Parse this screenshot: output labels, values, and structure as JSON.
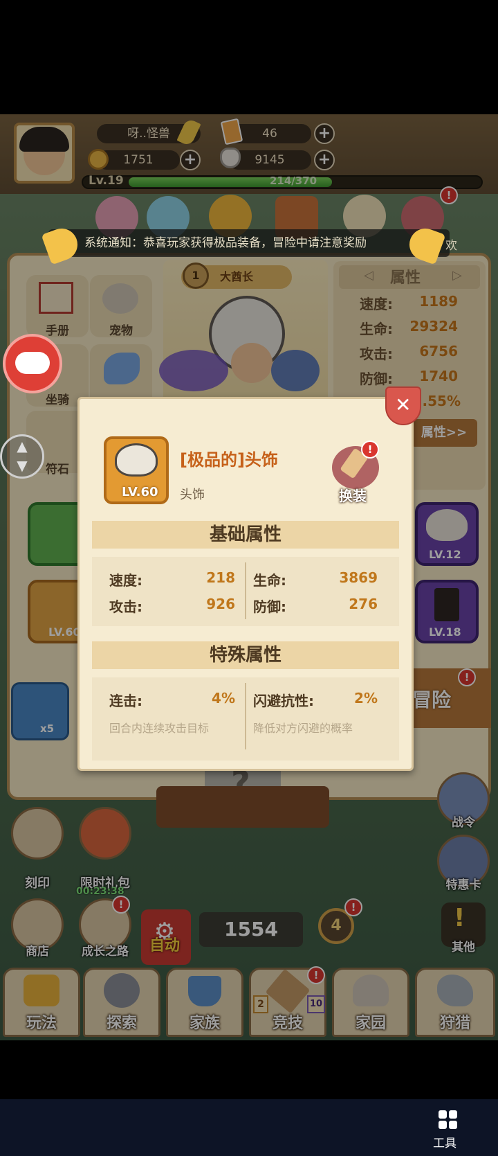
{
  "player": {
    "name": "呀..怪兽",
    "tickets": "46",
    "gold": "1751",
    "gems": "9145",
    "level": "Lv.19",
    "exp": "214/370",
    "exp_progress": 0.578
  },
  "banner": {
    "text": "系统通知：恭喜玩家获得极品装备，冒险中请注意奖励",
    "right_fragment": "欢"
  },
  "sidebar_left": [
    "手册",
    "宠物",
    "坐骑",
    "符石"
  ],
  "hero": {
    "rank_number": "1",
    "rank_title": "大酋长"
  },
  "attributes": {
    "title": "属性",
    "rows": [
      {
        "label": "速度:",
        "value": "1189"
      },
      {
        "label": "生命:",
        "value": "29324"
      },
      {
        "label": "攻击:",
        "value": "6756"
      },
      {
        "label": "防御:",
        "value": "1740"
      },
      {
        "label": "",
        "value": "3.55%"
      }
    ],
    "more_button": "属性>>"
  },
  "equipment": [
    {
      "level": "LV.12"
    },
    {
      "level": "LV.18"
    },
    {
      "level": "LV.60"
    }
  ],
  "adventure": {
    "label": "冒险",
    "chest_count": "x5"
  },
  "modal": {
    "item_name": "[极品的]头饰",
    "item_type": "头饰",
    "item_level": "LV.60",
    "swap_button": "换装",
    "basic_title": "基础属性",
    "basic_stats": [
      {
        "label": "速度:",
        "value": "218"
      },
      {
        "label": "生命:",
        "value": "3869"
      },
      {
        "label": "攻击:",
        "value": "926"
      },
      {
        "label": "防御:",
        "value": "276"
      }
    ],
    "special_title": "特殊属性",
    "special_stats": [
      {
        "label": "连击:",
        "value": "4%",
        "desc": "回合内连续攻击目标"
      },
      {
        "label": "闪避抗性:",
        "value": "2%",
        "desc": "降低对方闪避的概率"
      }
    ]
  },
  "right_buttons": [
    "战令",
    "特惠卡",
    "其他"
  ],
  "left_buttons": [
    "刻印",
    "限时礼包",
    "商店",
    "成长之路"
  ],
  "gift_timer": "00:23:38",
  "auto_button": "自动",
  "power_value": "1554",
  "badge_count": "4",
  "bottom_nav": [
    "玩法",
    "探索",
    "家族",
    "竞技",
    "家园",
    "狩猎"
  ],
  "arena_badges": {
    "left": "2",
    "right": "10"
  },
  "tools_label": "工具",
  "colors": {
    "accent_orange": "#c7761a",
    "panel_bg": "#f4e7c4",
    "alert_red": "#d9362f",
    "xp_green": "#4fb23a"
  }
}
